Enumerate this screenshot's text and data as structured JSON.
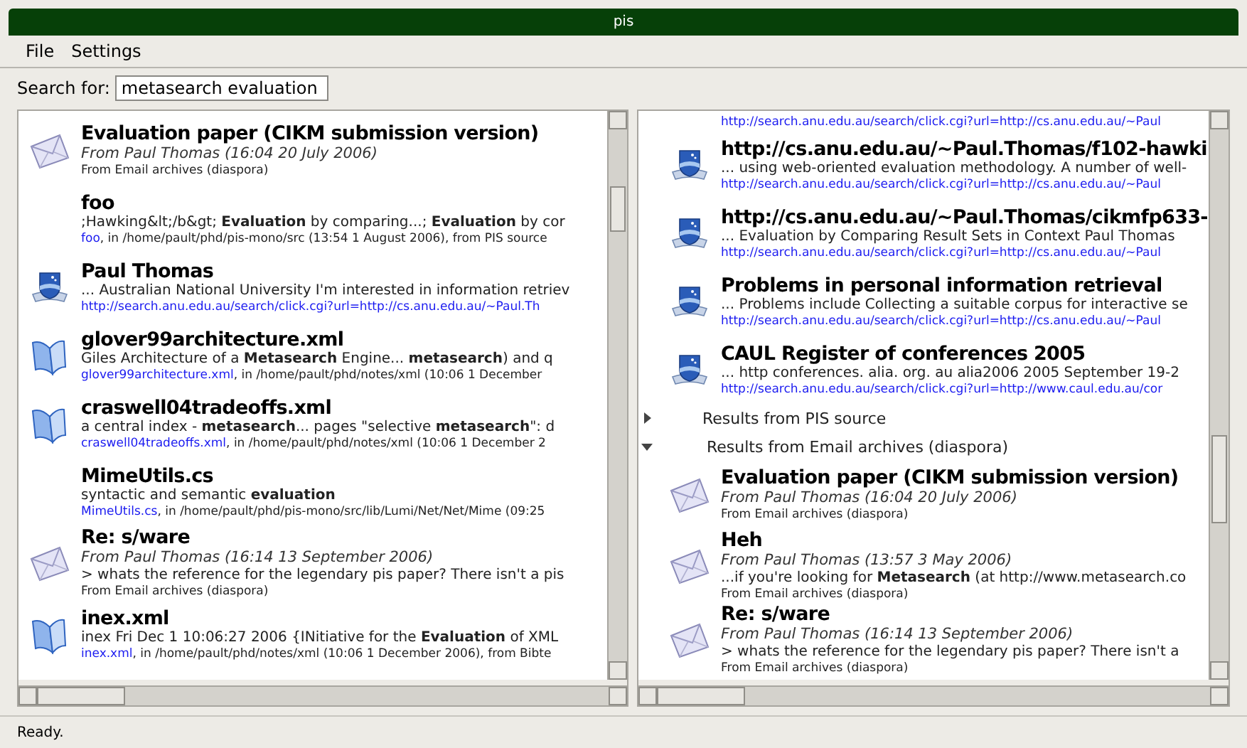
{
  "window": {
    "title": "pis"
  },
  "menu": [
    {
      "label": "File"
    },
    {
      "label": "Settings"
    }
  ],
  "search": {
    "label": "Search for:",
    "value": "metasearch evaluation"
  },
  "left_pane": {
    "items": [
      {
        "kind": "email",
        "title": "Evaluation paper (CIKM submission version)",
        "from": "From Paul Thomas (16:04 20 July 2006)",
        "source": "From Email archives (diaspora)"
      },
      {
        "kind": "plain",
        "title": "foo",
        "snippet": ";Hawking&lt;/b&gt; **Evaluation** by comparing...; **Evaluation** by cor",
        "link": "foo",
        "location": ", in /home/pault/phd/pis-mono/src (13:54 1 August 2006), from PIS source"
      },
      {
        "kind": "web",
        "title": "Paul Thomas",
        "snippet": "... Australian National University I'm interested in information retriev",
        "url": "http://search.anu.edu.au/search/click.cgi?url=http://cs.anu.edu.au/~Paul.Th"
      },
      {
        "kind": "file",
        "title": "glover99architecture.xml",
        "snippet": " Giles Architecture of a **Metasearch** Engine... **metasearch**) and q",
        "link": "glover99architecture.xml",
        "location": ", in /home/pault/phd/notes/xml (10:06 1 December"
      },
      {
        "kind": "file",
        "title": "craswell04tradeoffs.xml",
        "snippet": " a central index - **metasearch**... pages \"selective **metasearch**\": d",
        "link": "craswell04tradeoffs.xml",
        "location": ", in /home/pault/phd/notes/xml (10:06 1 December 2"
      },
      {
        "kind": "plain",
        "title": "MimeUtils.cs",
        "snippet": " syntactic and semantic **evaluation**",
        "link": "MimeUtils.cs",
        "location": ", in /home/pault/phd/pis-mono/src/lib/Lumi/Net/Net/Mime (09:25"
      },
      {
        "kind": "email",
        "title": "Re: s/ware",
        "from": "From Paul Thomas (16:14 13 September 2006)",
        "snippet": "> whats the reference for the legendary pis paper? There isn't a pis",
        "source": "From Email archives (diaspora)"
      },
      {
        "kind": "file",
        "title": "inex.xml",
        "snippet": "inex Fri Dec 1 10:06:27 2006 {INitiative for the **Evaluation** of XML",
        "link": "inex.xml",
        "location": ", in /home/pault/phd/notes/xml (10:06 1 December 2006), from Bibte"
      }
    ]
  },
  "right_pane": {
    "items": [
      {
        "kind": "fragment",
        "url": "http://search.anu.edu.au/search/click.cgi?url=http://cs.anu.edu.au/~Paul"
      },
      {
        "kind": "web",
        "title": "http://cs.anu.edu.au/~Paul.Thomas/f102-hawki",
        "snippet": "... using web-oriented evaluation methodology. A number of well-",
        "url": "http://search.anu.edu.au/search/click.cgi?url=http://cs.anu.edu.au/~Paul"
      },
      {
        "kind": "web",
        "title": "http://cs.anu.edu.au/~Paul.Thomas/cikmfp633-",
        "snippet": "... Evaluation by Comparing Result Sets in Context Paul Thomas",
        "url": "http://search.anu.edu.au/search/click.cgi?url=http://cs.anu.edu.au/~Paul"
      },
      {
        "kind": "web",
        "title": "Problems in personal information retrieval",
        "snippet": "... Problems include Collecting a suitable corpus for interactive se",
        "url": "http://search.anu.edu.au/search/click.cgi?url=http://cs.anu.edu.au/~Paul"
      },
      {
        "kind": "web",
        "title": "CAUL Register of conferences 2005",
        "snippet": "... http conferences. alia. org. au alia2006 2005 September 19-2",
        "url": "http://search.anu.edu.au/search/click.cgi?url=http://www.caul.edu.au/cor"
      },
      {
        "kind": "group",
        "label": "Results from PIS source",
        "expanded": false
      },
      {
        "kind": "group",
        "label": "Results from Email archives (diaspora)",
        "expanded": true
      },
      {
        "kind": "email",
        "title": "Evaluation paper (CIKM submission version)",
        "from": "From Paul Thomas (16:04 20 July 2006)",
        "source": "From Email archives (diaspora)"
      },
      {
        "kind": "email",
        "title": "Heh",
        "from": "From Paul Thomas (13:57 3 May 2006)",
        "snippet": "...if you're looking for **Metasearch** (at http://www.metasearch.co",
        "source": "From Email archives (diaspora)"
      },
      {
        "kind": "email",
        "title": "Re: s/ware",
        "from": "From Paul Thomas (16:14 13 September 2006)",
        "snippet": "> whats the reference for the legendary pis paper? There isn't a",
        "source": "From Email archives (diaspora)"
      }
    ]
  },
  "status_bar": {
    "text": "Ready."
  }
}
